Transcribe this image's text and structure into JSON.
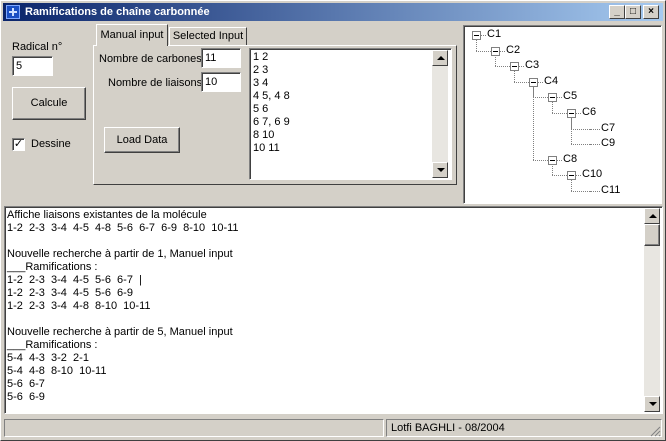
{
  "window": {
    "title": "Ramifications de chaîne carbonnée"
  },
  "titlebar_buttons": {
    "minimize": "_",
    "maximize": "□",
    "close": "×"
  },
  "left": {
    "radical_label": "Radical n°",
    "radical_value": "5",
    "calcule_label": "Calcule",
    "dessine_label": "Dessine",
    "dessine_checked": true,
    "check_glyph": "✓"
  },
  "tabs": [
    {
      "label": "Manual input",
      "active": true
    },
    {
      "label": "Selected Input",
      "active": false
    }
  ],
  "manual": {
    "carbones_label": "Nombre de carbones",
    "carbones_value": "11",
    "liaisons_label": "Nombre de liaisons",
    "liaisons_value": "10",
    "load_label": "Load Data",
    "lines": [
      "1 2",
      "2 3",
      "3 4",
      "4 5, 4 8",
      "5 6",
      "6 7, 6 9",
      "8 10",
      "10 11"
    ]
  },
  "tree": [
    {
      "label": "C1",
      "depth": 0,
      "expandable": true
    },
    {
      "label": "C2",
      "depth": 1,
      "expandable": true
    },
    {
      "label": "C3",
      "depth": 2,
      "expandable": true
    },
    {
      "label": "C4",
      "depth": 3,
      "expandable": true
    },
    {
      "label": "C5",
      "depth": 4,
      "expandable": true
    },
    {
      "label": "C6",
      "depth": 5,
      "expandable": true
    },
    {
      "label": "C7",
      "depth": 6,
      "expandable": false
    },
    {
      "label": "C9",
      "depth": 6,
      "expandable": false
    },
    {
      "label": "C8",
      "depth": 4,
      "expandable": true
    },
    {
      "label": "C10",
      "depth": 5,
      "expandable": true
    },
    {
      "label": "C11",
      "depth": 6,
      "expandable": false
    }
  ],
  "output_lines": [
    "Affiche liaisons existantes de la molécule",
    "1-2  2-3  3-4  4-5  4-8  5-6  6-7  6-9  8-10  10-11",
    "",
    "Nouvelle recherche à partir de 1, Manuel input",
    "___Ramifications :",
    "1-2  2-3  3-4  4-5  5-6  6-7  |",
    "1-2  2-3  3-4  4-5  5-6  6-9",
    "1-2  2-3  3-4  4-8  8-10  10-11",
    "",
    "Nouvelle recherche à partir de 5, Manuel input",
    "___Ramifications :",
    "5-4  4-3  3-2  2-1",
    "5-4  4-8  8-10  10-11",
    "5-6  6-7",
    "5-6  6-9"
  ],
  "status": {
    "panel1": "",
    "panel2": "Lotfi BAGHLI - 08/2004"
  }
}
